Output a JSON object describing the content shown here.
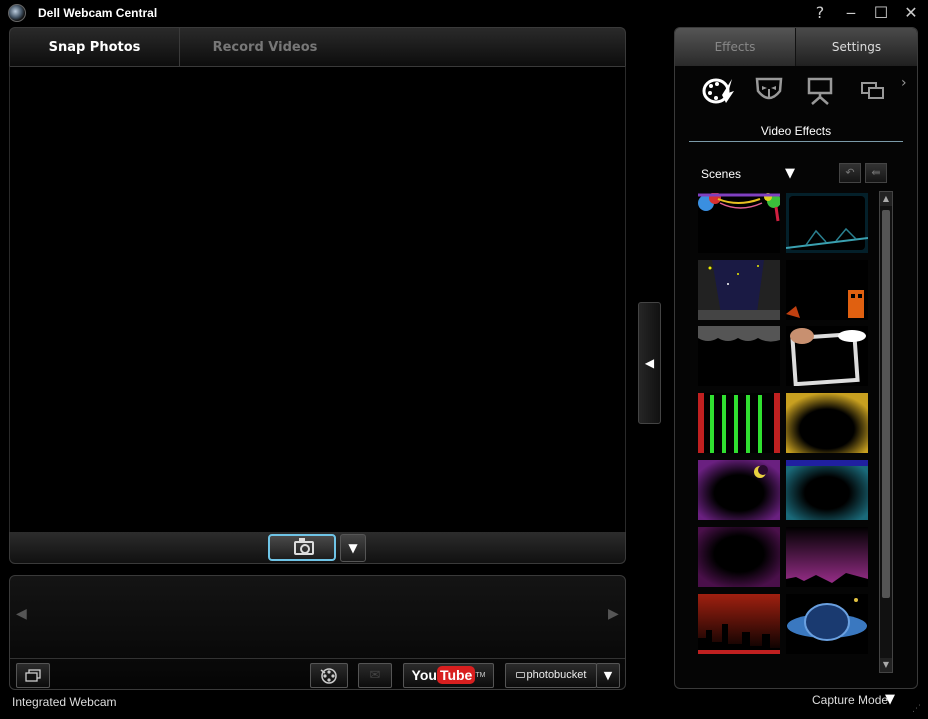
{
  "window": {
    "title": "Dell Webcam Central",
    "help": "?",
    "minimize": "‒",
    "maximize": "☐",
    "close": "✕"
  },
  "left_tabs": [
    {
      "label": "Snap Photos",
      "active": true
    },
    {
      "label": "Record Videos",
      "active": false
    }
  ],
  "capture": {
    "dropdown_arrow": "▼"
  },
  "gallery": {
    "prev": "◀",
    "next": "▶",
    "email_icon": "✉",
    "share_arrow": "▼"
  },
  "youtube": {
    "you": "You",
    "tube": "Tube",
    "tm": "TM"
  },
  "photobucket": {
    "label": "photobucket"
  },
  "status": {
    "source": "Integrated Webcam",
    "mode": "Capture Mode",
    "mode_arrow": "▼"
  },
  "right_tabs": [
    {
      "label": "Effects",
      "active": true
    },
    {
      "label": "Settings",
      "active": false
    }
  ],
  "effects": {
    "more": "›",
    "section_title": "Video Effects",
    "category": "Scenes",
    "category_arrow": "▼",
    "undo": "↶",
    "apply": "⇚"
  },
  "scroll": {
    "up": "▲",
    "down": "▼"
  },
  "collapse_arrow": "◀"
}
